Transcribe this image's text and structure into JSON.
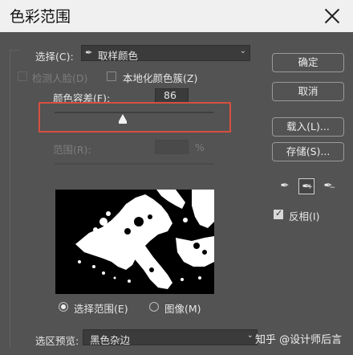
{
  "window": {
    "title": "色彩范围"
  },
  "select": {
    "label": "选择(C):",
    "value": "取样颜色"
  },
  "detect_faces": {
    "label": "检测人脸(D)",
    "checked": false,
    "enabled": false
  },
  "localized_clusters": {
    "label": "本地化颜色簇(Z)",
    "checked": false
  },
  "fuzziness": {
    "label": "颜色容差(F):",
    "value": "86",
    "level_fraction": 0.43
  },
  "range": {
    "label": "范围(R):",
    "value": "",
    "unit": "%"
  },
  "buttons": {
    "ok": "确定",
    "cancel": "取消",
    "load": "载入(L)...",
    "save": "存储(S)..."
  },
  "tools": [
    {
      "icon": "eyedropper-icon"
    },
    {
      "icon": "eyedropper-plus-icon",
      "active": true
    },
    {
      "icon": "eyedropper-minus-icon"
    }
  ],
  "invert": {
    "label": "反相(I)",
    "checked": true
  },
  "view": {
    "selection_label": "选择范围(E)",
    "image_label": "图像(M)",
    "selected": "selection"
  },
  "selection_preview": {
    "label": "选区预览:",
    "value": "黑色杂边"
  },
  "watermark": "知乎 @设计师后言",
  "colors": {
    "panel": "#535353",
    "highlight": "#d74f3f"
  }
}
